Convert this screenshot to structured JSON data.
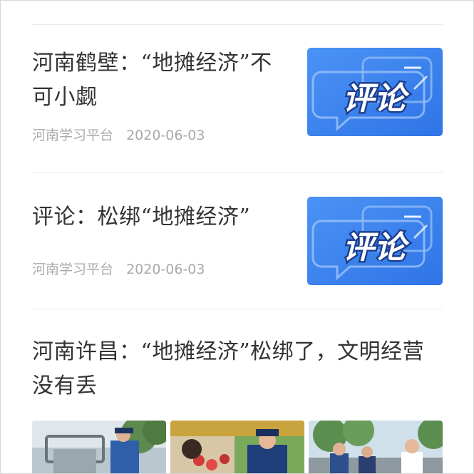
{
  "articles": [
    {
      "title": "河南鹤壁：“地摊经济”不可小觑",
      "source": "河南学习平台",
      "date": "2020-06-03",
      "thumbnail": {
        "icon": "comment-badge-icon",
        "label": "评论",
        "bg": "#3d86f0"
      }
    },
    {
      "title": "评论：松绑“地摊经济”",
      "source": "河南学习平台",
      "date": "2020-06-03",
      "thumbnail": {
        "icon": "comment-badge-icon",
        "label": "评论",
        "bg": "#3d86f0"
      }
    },
    {
      "title": "河南许昌：“地摊经济”松绑了，文明经营没有丢",
      "photos": [
        {
          "icon": "street-scene-photo-icon"
        },
        {
          "icon": "market-stall-photo-icon"
        },
        {
          "icon": "outdoor-crowd-photo-icon"
        }
      ]
    }
  ],
  "colors": {
    "title": "#333333",
    "meta": "#a9a9a9",
    "divider": "#e8e8e8",
    "badge_text": "#1e3f8f"
  }
}
